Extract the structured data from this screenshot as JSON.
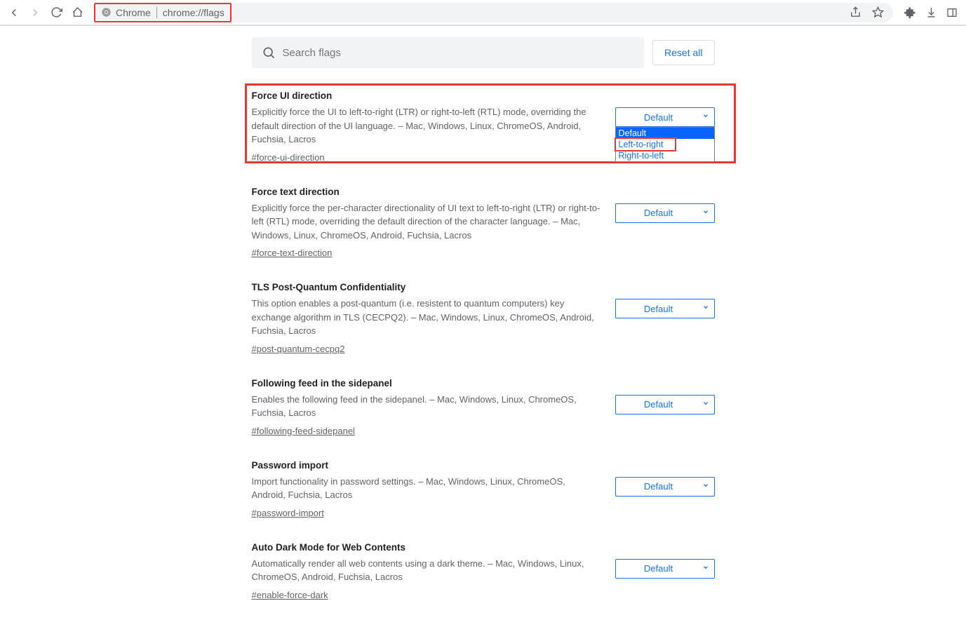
{
  "toolbar": {
    "chip_label": "Chrome",
    "url": "chrome://flags"
  },
  "search": {
    "placeholder": "Search flags"
  },
  "reset_label": "Reset all",
  "dropdown_options": {
    "default": "Default",
    "ltr": "Left-to-right",
    "rtl": "Right-to-left"
  },
  "flags": [
    {
      "title": "Force UI direction",
      "desc": "Explicitly force the UI to left-to-right (LTR) or right-to-left (RTL) mode, overriding the default direction of the UI language. – Mac, Windows, Linux, ChromeOS, Android, Fuchsia, Lacros",
      "anchor": "#force-ui-direction",
      "value": "Default"
    },
    {
      "title": "Force text direction",
      "desc": "Explicitly force the per-character directionality of UI text to left-to-right (LTR) or right-to-left (RTL) mode, overriding the default direction of the character language. – Mac, Windows, Linux, ChromeOS, Android, Fuchsia, Lacros",
      "anchor": "#force-text-direction",
      "value": "Default"
    },
    {
      "title": "TLS Post-Quantum Confidentiality",
      "desc": "This option enables a post-quantum (i.e. resistent to quantum computers) key exchange algorithm in TLS (CECPQ2). – Mac, Windows, Linux, ChromeOS, Android, Fuchsia, Lacros",
      "anchor": "#post-quantum-cecpq2",
      "value": "Default"
    },
    {
      "title": "Following feed in the sidepanel",
      "desc": "Enables the following feed in the sidepanel. – Mac, Windows, Linux, ChromeOS, Fuchsia, Lacros",
      "anchor": "#following-feed-sidepanel",
      "value": "Default"
    },
    {
      "title": "Password import",
      "desc": "Import functionality in password settings. – Mac, Windows, Linux, ChromeOS, Android, Fuchsia, Lacros",
      "anchor": "#password-import",
      "value": "Default"
    },
    {
      "title": "Auto Dark Mode for Web Contents",
      "desc": "Automatically render all web contents using a dark theme. – Mac, Windows, Linux, ChromeOS, Android, Fuchsia, Lacros",
      "anchor": "#enable-force-dark",
      "value": "Default"
    }
  ]
}
